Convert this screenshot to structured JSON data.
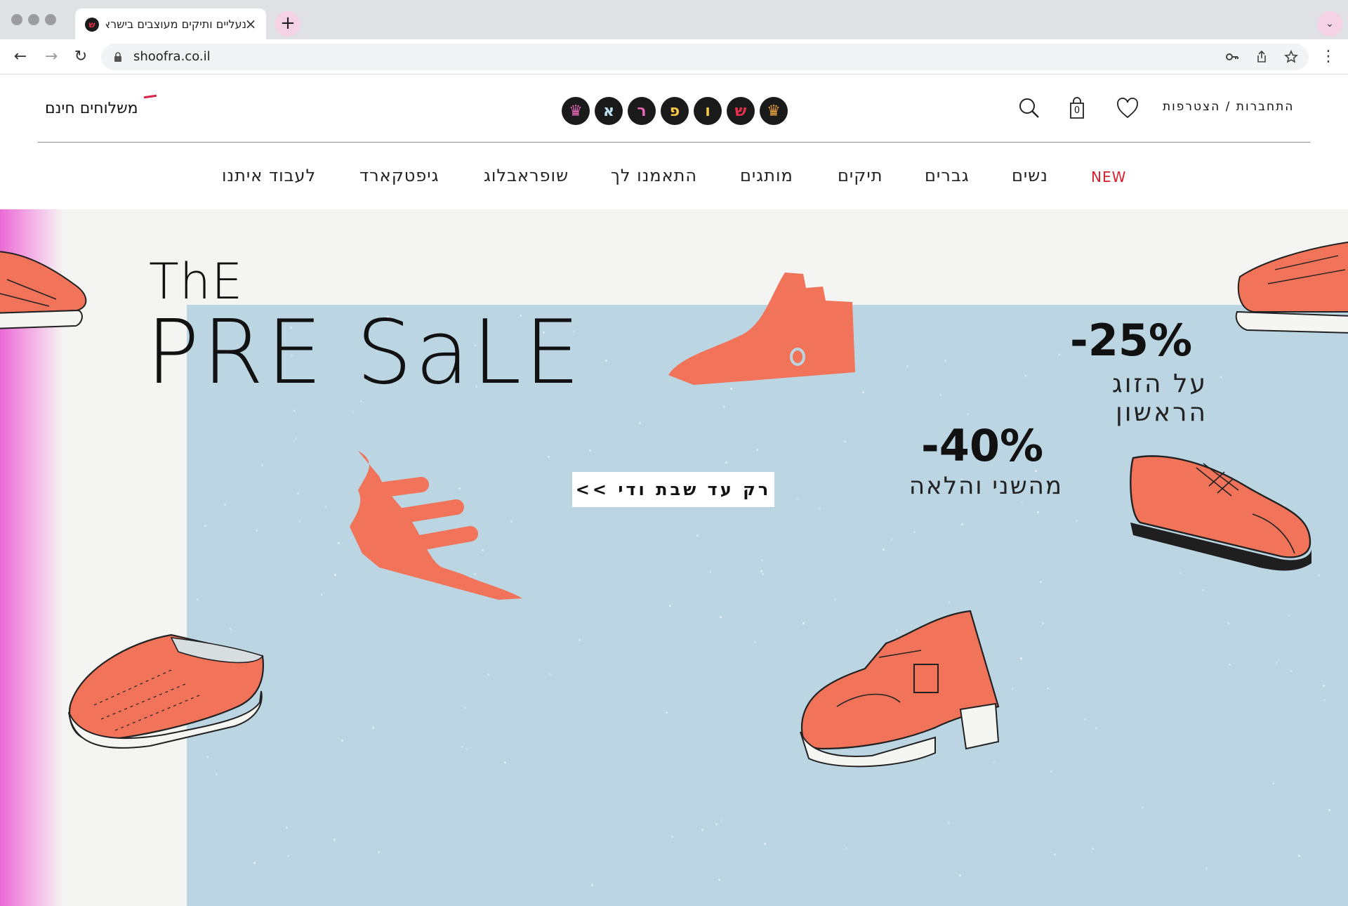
{
  "browser": {
    "tab_title": "נעליים ותיקים מעוצבים בישראל | שופרא · הזמנות במשלוח חינם עד הבית",
    "tab_close": "×",
    "new_tab": "+",
    "tab_menu": "⌄",
    "url": "shoofra.co.il",
    "back": "←",
    "forward": "→",
    "reload": "↻",
    "menu": "⋮"
  },
  "header": {
    "free_shipping": "משלוחים חינם",
    "logo_letters": [
      "♛",
      "ש",
      "ו",
      "פ",
      "ר",
      "א",
      "♛"
    ],
    "auth_links": "התחברות / הצטרפות",
    "cart_count": "0"
  },
  "nav": {
    "items": [
      "NEW",
      "נשים",
      "גברים",
      "תיקים",
      "מותגים",
      "התאמנו לך",
      "שופראבלוג",
      "גיפטקארד",
      "לעבוד איתנו"
    ]
  },
  "hero": {
    "title_top": "ThE",
    "title_main": "PRE SaLE",
    "deal1_percent": "-25%",
    "deal1_text": "על הזוג הראשון",
    "deal2_percent": "-40%",
    "deal2_text": "מהשני והלאה",
    "cta": "רק עד שבת ודי >>"
  },
  "colors": {
    "accent_red": "#d8202f",
    "hero_blue": "#bcd5e3",
    "shoe_orange": "#f0735a",
    "pink_edge": "#e96ad4"
  }
}
